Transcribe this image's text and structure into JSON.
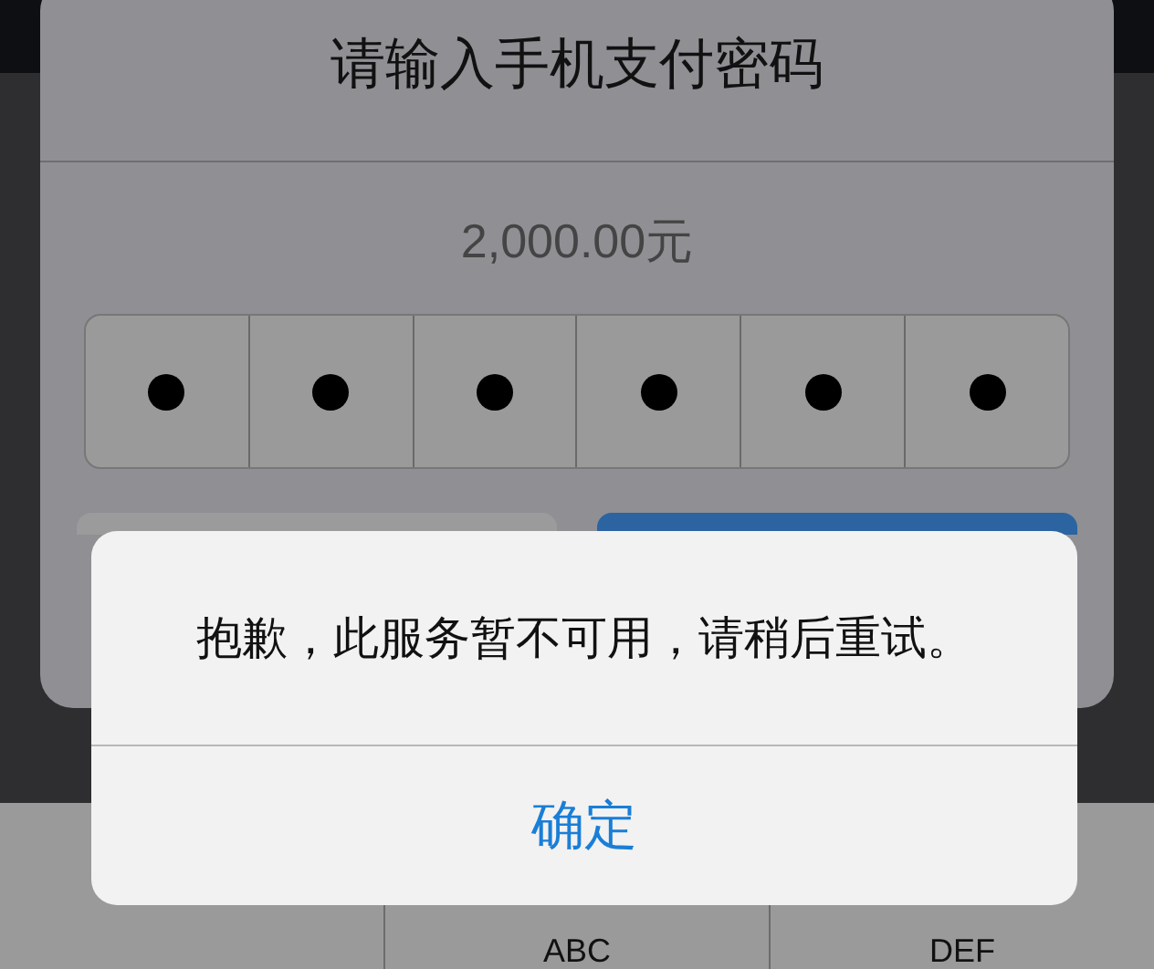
{
  "payment_dialog": {
    "title": "请输入手机支付密码",
    "amount": "2,000.00元",
    "pin_cells": [
      {
        "filled": true
      },
      {
        "filled": true
      },
      {
        "filled": true
      },
      {
        "filled": true
      },
      {
        "filled": true
      },
      {
        "filled": true
      }
    ],
    "buttons": [
      {
        "kind": "cancel"
      },
      {
        "kind": "confirm"
      }
    ]
  },
  "alert": {
    "message": "抱歉，此服务暂不可用，请稍后重试。",
    "button": "确定"
  },
  "keypad": {
    "keys": [
      {
        "kind": "blank"
      },
      {
        "kind": "letters",
        "letters": "ABC"
      },
      {
        "kind": "letters",
        "letters": "DEF"
      }
    ]
  }
}
